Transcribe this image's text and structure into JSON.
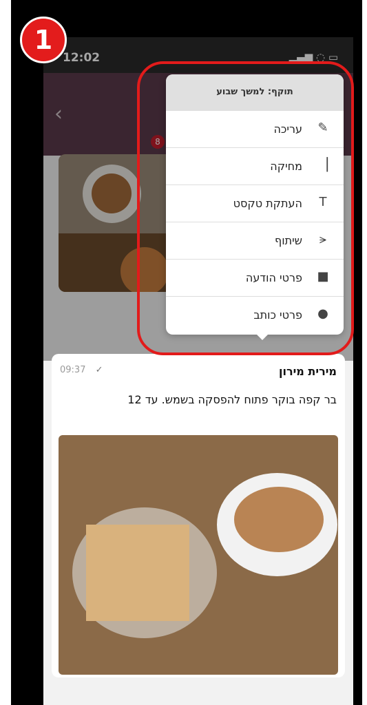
{
  "status_bar": {
    "time": "12:02",
    "indicators": "▂▄▆ ◌ ▭"
  },
  "step_marker": "1",
  "badge_count": "8",
  "context_menu": {
    "header": "תוקף: למשך שבוע",
    "items": [
      {
        "label": "עריכה",
        "icon": "✎"
      },
      {
        "label": "מחיקה",
        "icon": "▕"
      },
      {
        "label": "העתקת טקסט",
        "icon": "T"
      },
      {
        "label": "שיתוף",
        "icon": "⪪"
      },
      {
        "label": "פרטי הודעה",
        "icon": "■"
      },
      {
        "label": "פרטי כותב",
        "icon": "●"
      }
    ]
  },
  "message": {
    "sender": "מירית מירון",
    "time": "09:37",
    "status_mark": "✓",
    "text": "בר קפה בוקר פתוח להפסקה בשמש. עד 12"
  },
  "colors": {
    "highlight": "#e21b1b",
    "header": "#5a3a4a",
    "badge": "#c21d2b"
  }
}
